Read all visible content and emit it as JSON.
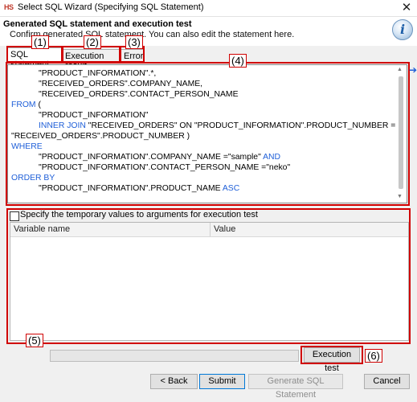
{
  "window": {
    "app_icon": "HS",
    "title": "Select SQL Wizard (Specifying SQL Statement)",
    "close_icon": "✕"
  },
  "header": {
    "heading": "Generated SQL statement and execution test",
    "description": "Confirm generated SQL statement. You can also edit the statement here.",
    "info_icon": "i"
  },
  "tabs": [
    {
      "label": "SQL statement",
      "active": true
    },
    {
      "label": "Execution result",
      "active": false
    },
    {
      "label": "Error",
      "active": false
    }
  ],
  "markers": [
    "(1)",
    "(2)",
    "(3)",
    "(4)",
    "(5)",
    "(6)"
  ],
  "sql_lines": [
    {
      "indent": true,
      "parts": [
        {
          "t": "\"PRODUCT_INFORMATION\".*,",
          "kw": false
        }
      ]
    },
    {
      "indent": true,
      "parts": [
        {
          "t": "\"RECEIVED_ORDERS\".COMPANY_NAME,",
          "kw": false
        }
      ]
    },
    {
      "indent": true,
      "parts": [
        {
          "t": "\"RECEIVED_ORDERS\".CONTACT_PERSON_NAME",
          "kw": false
        }
      ]
    },
    {
      "indent": false,
      "parts": [
        {
          "t": "FROM",
          "kw": true
        },
        {
          "t": " (",
          "kw": false
        }
      ]
    },
    {
      "indent": true,
      "parts": [
        {
          "t": "\"PRODUCT_INFORMATION\"",
          "kw": false
        }
      ]
    },
    {
      "indent": true,
      "parts": [
        {
          "t": "INNER JOIN",
          "kw": true
        },
        {
          "t": " \"RECEIVED_ORDERS\" ON \"PRODUCT_INFORMATION\".PRODUCT_NUMBER =",
          "kw": false
        }
      ]
    },
    {
      "indent": false,
      "parts": [
        {
          "t": "\"RECEIVED_ORDERS\".PRODUCT_NUMBER )",
          "kw": false
        }
      ]
    },
    {
      "indent": false,
      "parts": [
        {
          "t": "WHERE",
          "kw": true
        }
      ]
    },
    {
      "indent": true,
      "parts": [
        {
          "t": "\"PRODUCT_INFORMATION\".COMPANY_NAME =\"sample\" ",
          "kw": false
        },
        {
          "t": "AND",
          "kw": true
        }
      ]
    },
    {
      "indent": true,
      "parts": [
        {
          "t": "\"PRODUCT_INFORMATION\".CONTACT_PERSON_NAME =\"neko\"",
          "kw": false
        }
      ]
    },
    {
      "indent": false,
      "parts": [
        {
          "t": "ORDER BY",
          "kw": true
        }
      ]
    },
    {
      "indent": true,
      "parts": [
        {
          "t": "\"PRODUCT_INFORMATION\".PRODUCT_NAME ",
          "kw": false
        },
        {
          "t": "ASC",
          "kw": true
        }
      ]
    }
  ],
  "temp_values": {
    "checkbox_label": "Specify the temporary values to arguments for execution test",
    "checked": false,
    "columns": [
      "Variable name",
      "Value"
    ]
  },
  "buttons": {
    "execution_test": "Execution test",
    "back": "< Back",
    "submit": "Submit",
    "generate": "Generate SQL Statement",
    "cancel": "Cancel"
  },
  "colors": {
    "keyword": "#1f5fd8",
    "highlight_box": "#d00000"
  }
}
